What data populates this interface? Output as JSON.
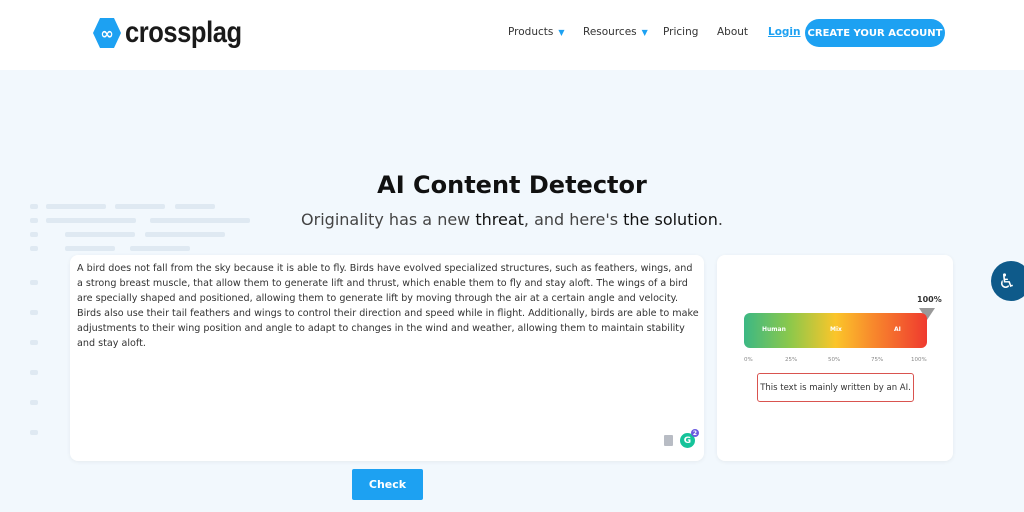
{
  "header": {
    "logo_text": "crossplag",
    "nav": [
      {
        "label": "Products",
        "dropdown": true
      },
      {
        "label": "Resources",
        "dropdown": true
      },
      {
        "label": "Pricing"
      },
      {
        "label": "About"
      }
    ],
    "login": "Login",
    "cta": "CREATE YOUR ACCOUNT"
  },
  "hero": {
    "title": "AI Content Detector",
    "subtitle_1": "Originality has a new ",
    "subtitle_2": "threat",
    "subtitle_3": ", and here's ",
    "subtitle_4": "the solution",
    "subtitle_5": "."
  },
  "editor": {
    "text": "A bird does not fall from the sky because it is able to fly. Birds have evolved specialized structures, such as feathers, wings, and a strong breast muscle, that allow them to generate lift and thrust, which enable them to fly and stay aloft. The wings of a bird are specially shaped and positioned, allowing them to generate lift by moving through the air at a certain angle and velocity. Birds also use their tail feathers and wings to control their direction and speed while in flight. Additionally, birds are able to make adjustments to their wing position and angle to adapt to changes in the wind and weather, allowing them to maintain stability and stay aloft.",
    "grammarly_count": "2"
  },
  "result": {
    "score": "100%",
    "score_value": 100,
    "labels": [
      "Human",
      "Mix",
      "AI"
    ],
    "ticks": [
      "0%",
      "25%",
      "50%",
      "75%",
      "100%"
    ],
    "verdict": "This text is mainly written by an AI.",
    "verdict_color": "#d9534f"
  },
  "check_label": "Check",
  "accent": "#1da1f2"
}
